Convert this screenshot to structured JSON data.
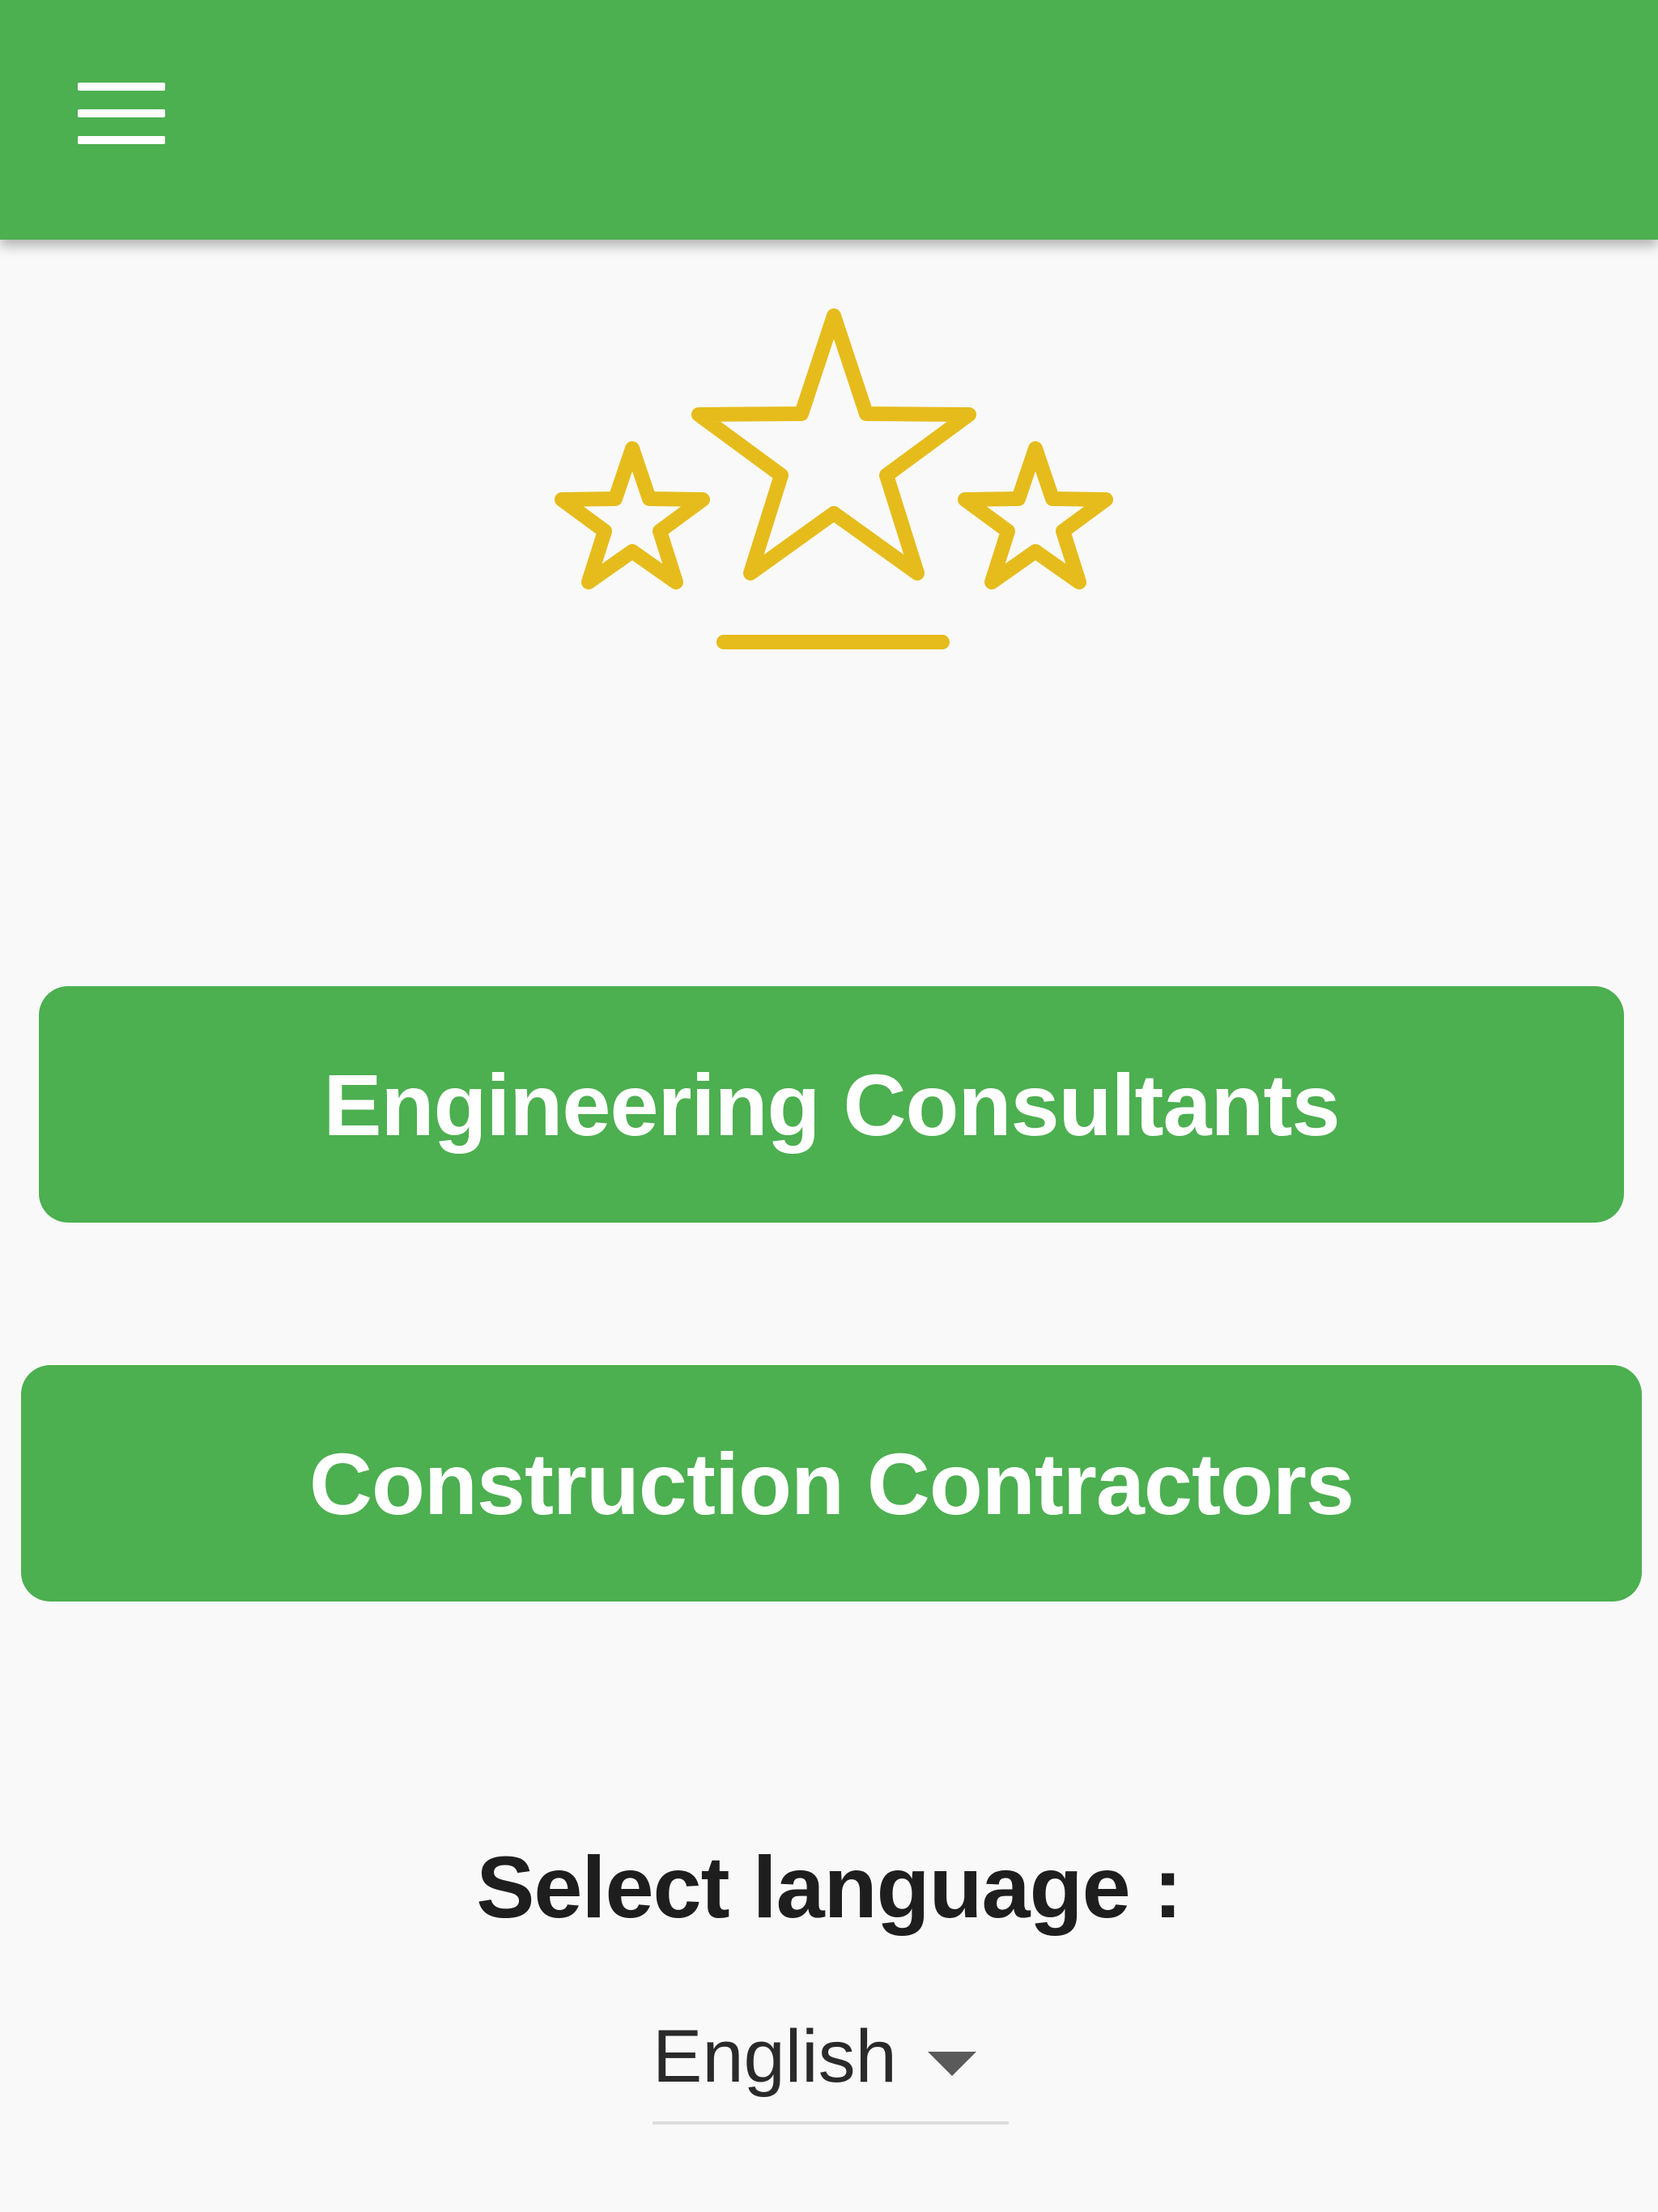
{
  "app_bar": {
    "menu_icon": "hamburger-menu-icon",
    "color": "#4caf50"
  },
  "logo": {
    "icon": "three-stars-icon",
    "color": "#e6bc1c"
  },
  "main": {
    "engineering_button_label": "Engineering Consultants",
    "construction_button_label": "Construction Contractors"
  },
  "language": {
    "title": "Select language :",
    "selected": "English"
  }
}
